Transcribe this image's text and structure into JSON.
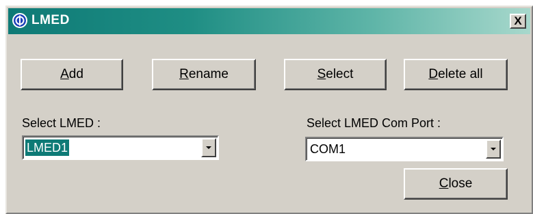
{
  "window": {
    "title": "LMED",
    "close_glyph": "X"
  },
  "buttons": {
    "add": {
      "accel": "A",
      "rest": "dd"
    },
    "rename": {
      "accel": "R",
      "rest": "ename"
    },
    "select": {
      "accel": "S",
      "rest": "elect"
    },
    "delete_all": {
      "accel": "D",
      "rest": "elete all"
    },
    "close": {
      "accel": "C",
      "rest": "lose"
    }
  },
  "select_lmed": {
    "label": "Select LMED :",
    "value": "LMED1"
  },
  "select_com_port": {
    "label": "Select LMED Com Port :",
    "value": "COM1"
  },
  "icons": {
    "title_logo": "phi-logo-icon",
    "dropdown_arrow": "chevron-down-icon"
  }
}
